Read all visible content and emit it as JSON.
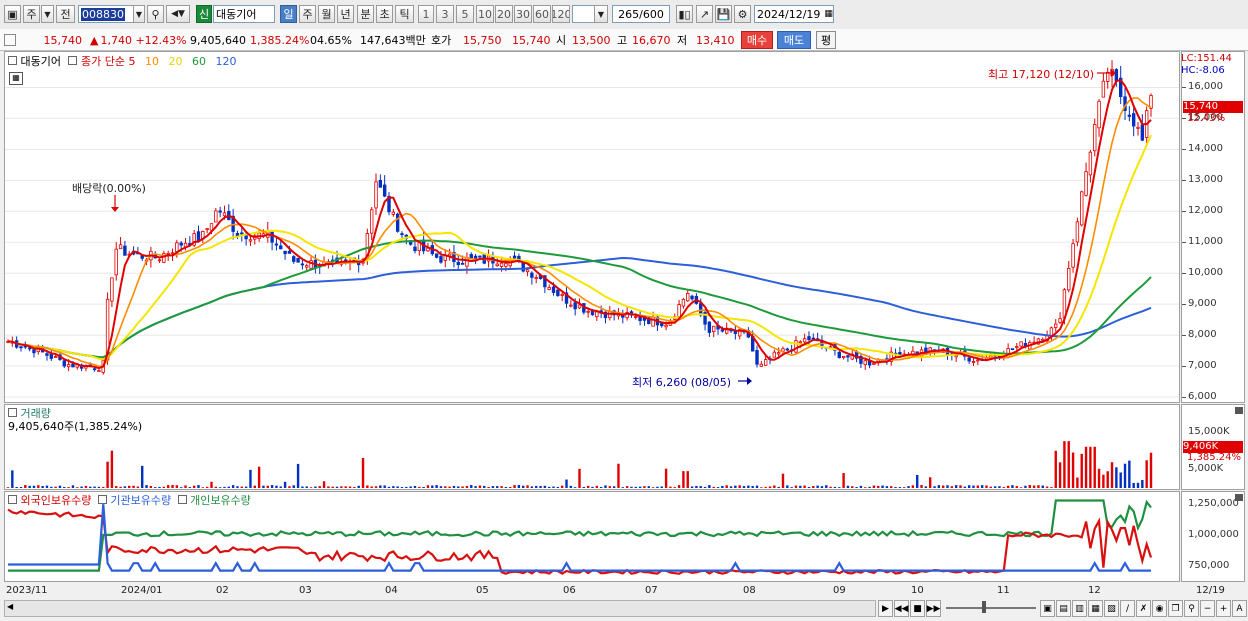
{
  "toolbar": {
    "market": "주",
    "view": "전",
    "stock_code": "008830",
    "badge": "신",
    "stock_name": "대동기어",
    "periods": [
      "일",
      "주",
      "월",
      "년",
      "분",
      "초",
      "틱"
    ],
    "intervals": [
      "1",
      "3",
      "5",
      "10",
      "20",
      "30",
      "60",
      "120"
    ],
    "count": "265",
    "count_total": "/600",
    "date": "2024/12/19"
  },
  "quote": {
    "price": "15,740",
    "change": "1,740 +12.43%",
    "volume": "9,405,640",
    "volume_ratio": "1,385.24%",
    "turnover": "04.65%",
    "amount": "147,643백만",
    "bid_label": "호가",
    "bid": "15,750",
    "ask": "15,740",
    "open_label": "시",
    "open": "13,500",
    "high_label": "고",
    "high": "16,670",
    "low_label": "저",
    "low": "13,410",
    "buy_label": "매수",
    "sell_label": "매도",
    "eval_label": "평"
  },
  "price_panel": {
    "name": "대동기어",
    "ma_title": "종가 단순",
    "ma_periods": [
      "5",
      "10",
      "20",
      "60",
      "120"
    ],
    "lc": "LC:151.44",
    "hc": "HC:-8.06",
    "dividend_note": "배당락(0.00%)",
    "high_note": "최고 17,120 (12/10)",
    "low_note": "최저 6,260 (08/05)",
    "current_tag": "15,740",
    "current_pct": "12.43%",
    "y_ticks": [
      "16,000",
      "15,000",
      "14,000",
      "13,000",
      "12,000",
      "11,000",
      "10,000",
      "9,000",
      "8,000",
      "7,000",
      "6,000"
    ]
  },
  "volume_panel": {
    "title": "거래량",
    "value": "9,405,640주(1,385.24%)",
    "tag": "9,406K",
    "tag_pct": "1,385.24%",
    "y_ticks": [
      "15,000K",
      "10,000K",
      "5,000K"
    ]
  },
  "holdings_panel": {
    "series": [
      "외국인보유수량",
      "기관보유수량",
      "개인보유수량"
    ],
    "y_ticks": [
      "1,250,000",
      "1,000,000",
      "750,000"
    ]
  },
  "x_axis": [
    "2023/11",
    "2024/01",
    "02",
    "03",
    "04",
    "05",
    "06",
    "07",
    "08",
    "09",
    "10",
    "11",
    "12",
    "12/19"
  ],
  "colors": {
    "ma5": "#e00000",
    "ma10": "#ff8c00",
    "ma20": "#f5e600",
    "ma60": "#1f9a3a",
    "ma120": "#2c5fd8",
    "up": "#e00000",
    "down": "#0030c0",
    "foreign": "#d81010",
    "institution": "#2c5fd8",
    "individual": "#209040"
  },
  "chart_data": {
    "type": "candlestick",
    "title": "대동기어",
    "x_range": [
      "2023/11",
      "2024/12/19"
    ],
    "ylim": [
      6000,
      16500
    ],
    "price_anchors": [
      {
        "date": "2023/11",
        "close": 7800
      },
      {
        "date": "2023/12 end",
        "close": 6950
      },
      {
        "date": "2023/12 end spike",
        "close": 11000
      },
      {
        "date": "2024/01",
        "close": 10500
      },
      {
        "date": "2024/02",
        "close": 12000
      },
      {
        "date": "2024/02 end",
        "close": 10100
      },
      {
        "date": "2024/03 end",
        "close": 13000
      },
      {
        "date": "2024/04",
        "close": 11000
      },
      {
        "date": "2024/05",
        "close": 10400
      },
      {
        "date": "2024/06",
        "close": 9000
      },
      {
        "date": "2024/07",
        "close": 8500
      },
      {
        "date": "2024/07 spike",
        "close": 9400
      },
      {
        "date": "2024/08/05",
        "close": 6260
      },
      {
        "date": "2024/09",
        "close": 7000
      },
      {
        "date": "2024/10",
        "close": 7400
      },
      {
        "date": "2024/11",
        "close": 7800
      },
      {
        "date": "2024/12/10",
        "close": 17120
      },
      {
        "date": "2024/12/19",
        "close": 15740
      }
    ],
    "ohlc_last": {
      "open": 13500,
      "high": 16670,
      "low": 13410,
      "close": 15740
    },
    "volume_last": 9405640
  }
}
